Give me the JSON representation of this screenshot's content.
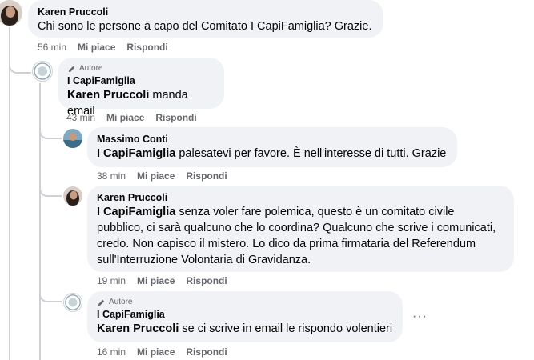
{
  "comments": [
    {
      "author": "Karen Pruccoli",
      "text": "Chi sono le persone a capo del Comitato I CapiFamiglia? Grazie.",
      "time": "56 min",
      "like": "Mi piace",
      "reply": "Rispondi"
    },
    {
      "badge": "Autore",
      "author": "I CapiFamiglia",
      "tag": "Karen Pruccoli",
      "text": "manda email",
      "time": "43 min",
      "like": "Mi piace",
      "reply": "Rispondi"
    },
    {
      "author": "Massimo Conti",
      "tag": "I CapiFamiglia",
      "text": "palesatevi per favore. È nell'interesse di tutti. Grazie",
      "time": "38 min",
      "like": "Mi piace",
      "reply": "Rispondi"
    },
    {
      "author": "Karen Pruccoli",
      "tag": "I CapiFamiglia",
      "line1": "senza voler fare polemica, questo è un comitato civile",
      "line2": "pubblico, ci sarà qualcuno che lo coordina? Qualcuno che scrive i comunicati,",
      "line3": "credo. Non capisco il mistero. Lo dico da prima firmataria del Referendum",
      "line4": "sull'Interruzione Volontaria di Gravidanza.",
      "time": "19 min",
      "like": "Mi piace",
      "reply": "Rispondi"
    },
    {
      "badge": "Autore",
      "author": "I CapiFamiglia",
      "tag": "Karen Pruccoli",
      "text": "se ci scrive in email le rispondo volentieri",
      "time": "16 min",
      "like": "Mi piace",
      "reply": "Rispondi",
      "more": "···"
    }
  ]
}
